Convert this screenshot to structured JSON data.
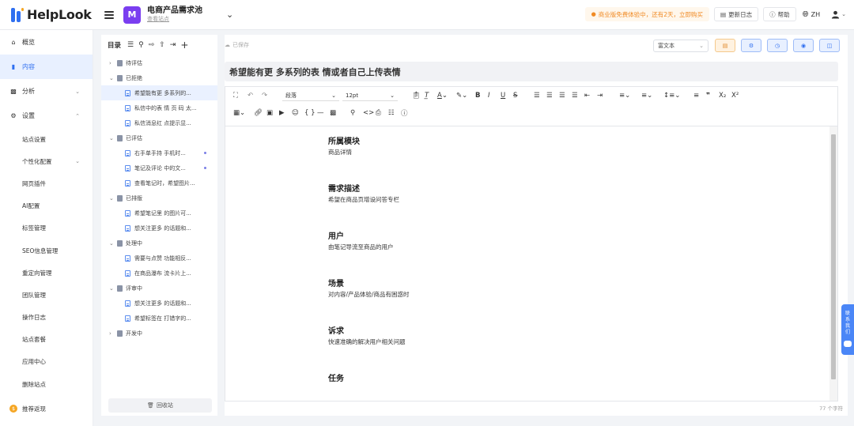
{
  "brand": {
    "name": "HelpLook"
  },
  "site": {
    "avatar_letter": "M",
    "name": "电商产品需求池",
    "link": "查看站点"
  },
  "top": {
    "promo": "商业版免费体验中，还有2天，立即购买",
    "changelog": "更新日志",
    "help": "帮助",
    "lang": "ZH"
  },
  "sidebar": {
    "items": [
      {
        "label": "概览",
        "icon": "home-icon"
      },
      {
        "label": "内容",
        "icon": "book-icon"
      },
      {
        "label": "分析",
        "icon": "chart-icon"
      },
      {
        "label": "设置",
        "icon": "gear-icon"
      }
    ],
    "settings_sub": [
      "站点设置",
      "个性化配置",
      "网页插件",
      "AI配置",
      "标签管理",
      "SEO信息管理",
      "重定向管理",
      "团队管理",
      "操作日志",
      "站点套餐",
      "应用中心",
      "删除站点"
    ],
    "referral": "推荐返现"
  },
  "tree": {
    "title": "目录",
    "recycle": "回收站",
    "rows": [
      {
        "type": "folder",
        "label": "待评估",
        "open": false
      },
      {
        "type": "folder",
        "label": "已拒绝",
        "open": true
      },
      {
        "type": "doc",
        "label": "希望能有更 多系列的...",
        "selected": true
      },
      {
        "type": "doc",
        "label": "私信中的表 情 页 码 太..."
      },
      {
        "type": "doc",
        "label": "私信消息红 点提示显..."
      },
      {
        "type": "folder",
        "label": "已评估",
        "open": true
      },
      {
        "type": "doc",
        "label": "右手单手持 手机时...",
        "dot": true
      },
      {
        "type": "doc",
        "label": "笔记及评论 中的文...",
        "dot": true
      },
      {
        "type": "doc",
        "label": "查看笔记时，希望图片..."
      },
      {
        "type": "folder",
        "label": "已排版",
        "open": true
      },
      {
        "type": "doc",
        "label": "希望笔记里 的图片可..."
      },
      {
        "type": "doc",
        "label": "想关注更多 的话题和..."
      },
      {
        "type": "folder",
        "label": "处理中",
        "open": true
      },
      {
        "type": "doc",
        "label": "需要与点赞 功能相反..."
      },
      {
        "type": "doc",
        "label": "在商品瀑布 流卡片上..."
      },
      {
        "type": "folder",
        "label": "评审中",
        "open": true
      },
      {
        "type": "doc",
        "label": "想关注更多 的话题和..."
      },
      {
        "type": "doc",
        "label": "希望标签在 打错字的..."
      },
      {
        "type": "folder",
        "label": "开发中",
        "open": false
      }
    ]
  },
  "editor": {
    "saved": "已保存",
    "mode": "富文本",
    "title": "希望能有更 多系列的表 情或者自己上传表情",
    "paragraph_style": "段落",
    "font_size": "12pt",
    "char_count": "77 个字符",
    "sections": [
      {
        "heading": "所属模块",
        "text": "商品详情"
      },
      {
        "heading": "需求描述",
        "text": "希望在商品页增设问答专栏"
      },
      {
        "heading": "用户",
        "text": "由笔记导流至商品的用户"
      },
      {
        "heading": "场景",
        "text": "对内容/产品体验/商品有困惑时"
      },
      {
        "heading": "诉求",
        "text": "快速准确的解决用户相关问题"
      },
      {
        "heading": "任务",
        "text": ""
      }
    ]
  },
  "contact": {
    "label": "联系我们"
  },
  "colors": {
    "accent": "#2f6ff0",
    "promo": "#f08a24",
    "site_avatar": "#7a3ef0"
  }
}
